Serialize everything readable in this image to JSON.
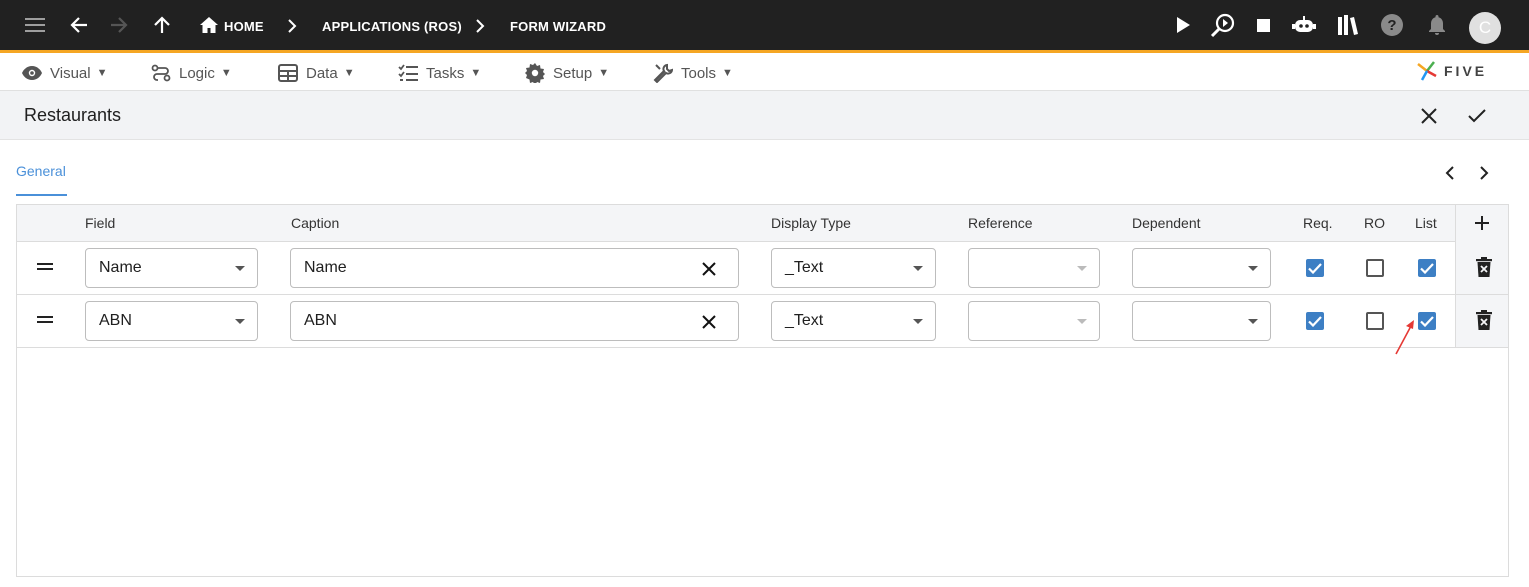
{
  "appbar": {
    "breadcrumbs": [
      "HOME",
      "APPLICATIONS (ROS)",
      "FORM WIZARD"
    ],
    "avatar_letter": "C",
    "accent_color": "#f5a623"
  },
  "menu": {
    "items": [
      "Visual",
      "Logic",
      "Data",
      "Tasks",
      "Setup",
      "Tools"
    ],
    "caret": "▼",
    "logo_text": "FIVE"
  },
  "page": {
    "title": "Restaurants",
    "tab": "General"
  },
  "grid": {
    "columns": [
      "Field",
      "Caption",
      "Display Type",
      "Reference",
      "Dependent",
      "Req.",
      "RO",
      "List"
    ],
    "rows": [
      {
        "field": "Name",
        "caption": "Name",
        "display_type": "_Text",
        "reference": "",
        "dependent": "",
        "req": true,
        "ro": false,
        "list": true
      },
      {
        "field": "ABN",
        "caption": "ABN",
        "display_type": "_Text",
        "reference": "",
        "dependent": "",
        "req": true,
        "ro": false,
        "list": true
      }
    ]
  },
  "colors": {
    "appbar_bg": "#212121",
    "checkbox_on": "#3d7fc4",
    "tab_active": "#4a90d9",
    "annotation_arrow": "#e53935"
  }
}
